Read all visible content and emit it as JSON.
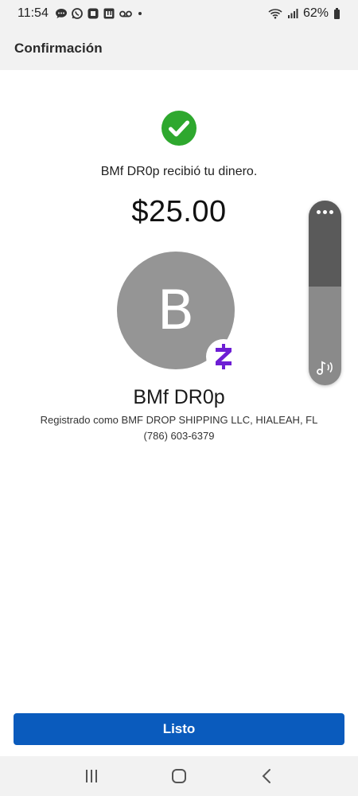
{
  "status_bar": {
    "time": "11:54",
    "battery": "62%",
    "icons": [
      "messages-icon",
      "whatsapp-icon",
      "app-icon",
      "m-app-icon",
      "voicemail-icon",
      "dot-icon",
      "wifi-icon",
      "signal-icon",
      "battery-icon"
    ]
  },
  "header": {
    "title": "Confirmación"
  },
  "confirmation": {
    "message": "BMf DR0p recibió tu dinero.",
    "amount": "$25.00",
    "avatar_letter": "B",
    "recipient_name": "BMf DR0p",
    "registered": "Registrado como BMF DROP SHIPPING LLC, HIALEAH, FL",
    "phone": "(786) 603-6379"
  },
  "volume": {
    "icons": [
      "more-dots-icon",
      "sound-icon"
    ]
  },
  "footer": {
    "done_label": "Listo"
  },
  "nav": {
    "icons": [
      "recent-apps-icon",
      "home-icon",
      "back-icon"
    ]
  },
  "colors": {
    "primary_button": "#0a5bbd",
    "success": "#2ea82e",
    "zelle": "#6d1ed4",
    "avatar": "#959595"
  }
}
